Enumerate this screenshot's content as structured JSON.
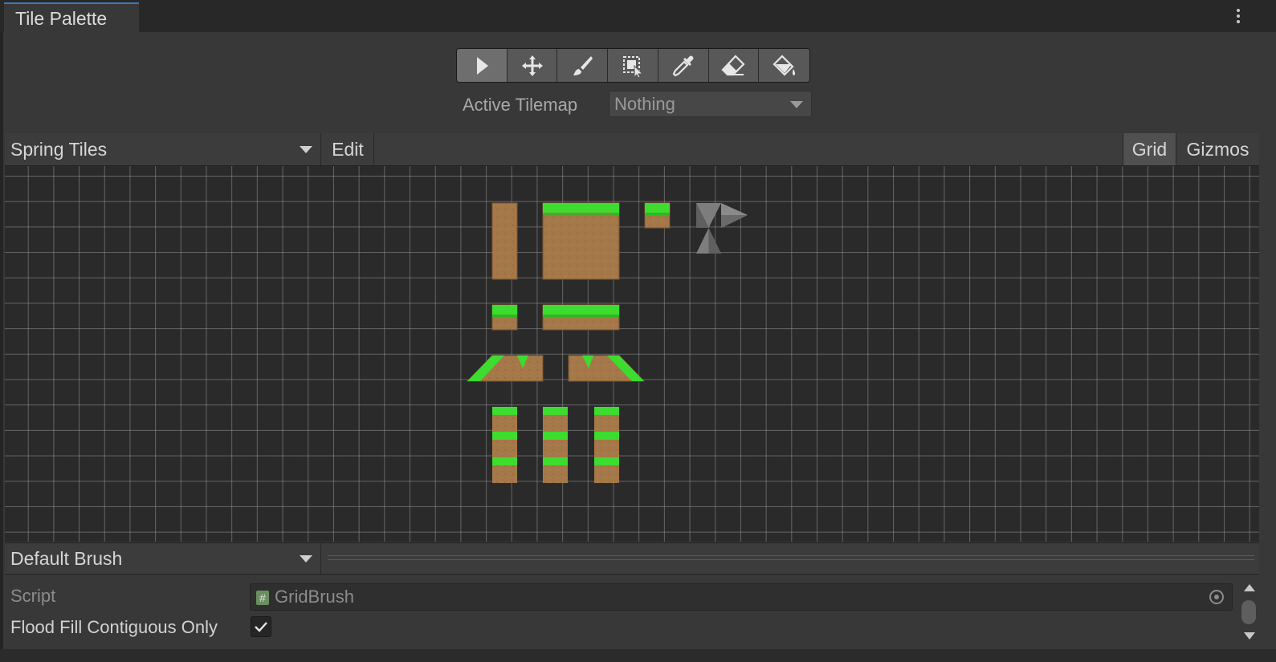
{
  "window": {
    "tab_title": "Tile Palette",
    "menu_icon": "kebab-menu-icon"
  },
  "toolbar": {
    "tools": [
      {
        "name": "select-tool",
        "icon": "select-arrow-icon",
        "active": true
      },
      {
        "name": "move-tool",
        "icon": "move-icon",
        "active": false
      },
      {
        "name": "paint-tool",
        "icon": "brush-icon",
        "active": false
      },
      {
        "name": "box-fill-tool",
        "icon": "box-fill-icon",
        "active": false
      },
      {
        "name": "pick-tool",
        "icon": "eyedropper-icon",
        "active": false
      },
      {
        "name": "erase-tool",
        "icon": "eraser-icon",
        "active": false
      },
      {
        "name": "fill-tool",
        "icon": "paint-bucket-icon",
        "active": false
      }
    ]
  },
  "active_tilemap": {
    "label": "Active Tilemap",
    "value": "Nothing"
  },
  "palette_bar": {
    "palette_name": "Spring Tiles",
    "edit_label": "Edit",
    "grid_label": "Grid",
    "gizmos_label": "Gizmos"
  },
  "brush_bar": {
    "brush_name": "Default Brush"
  },
  "inspector": {
    "script_label": "Script",
    "script_value": "GridBrush",
    "flood_fill_label": "Flood Fill Contiguous Only",
    "flood_fill_checked": true
  },
  "colors": {
    "grass": "#3ddc2e",
    "dirt": "#a57849",
    "accent_tab": "#3a79bb"
  }
}
